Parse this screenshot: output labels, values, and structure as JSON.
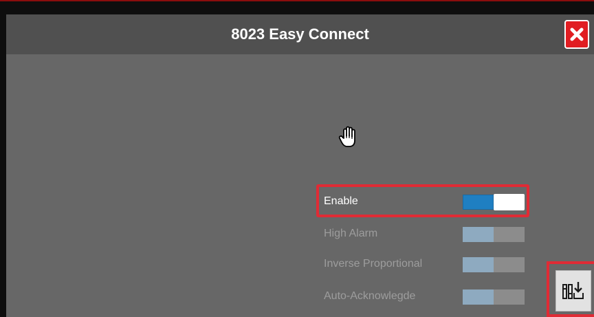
{
  "window": {
    "title": "8023 Easy Connect"
  },
  "icons": {
    "close": "close-icon",
    "cursor": "hand-cursor-icon",
    "save": "save-settings-icon"
  },
  "colors": {
    "close_bg": "#e11d22",
    "highlight": "#e02b35",
    "toggle_on": "#1f7fc2",
    "toggle_disabled": "#8eaac0"
  },
  "options": [
    {
      "label": "Enable",
      "state": "on",
      "enabled": true
    },
    {
      "label": "High Alarm",
      "state": "on",
      "enabled": false
    },
    {
      "label": "Inverse Proportional",
      "state": "on",
      "enabled": false
    },
    {
      "label": "Auto-Acknowlegde",
      "state": "on",
      "enabled": false
    }
  ]
}
